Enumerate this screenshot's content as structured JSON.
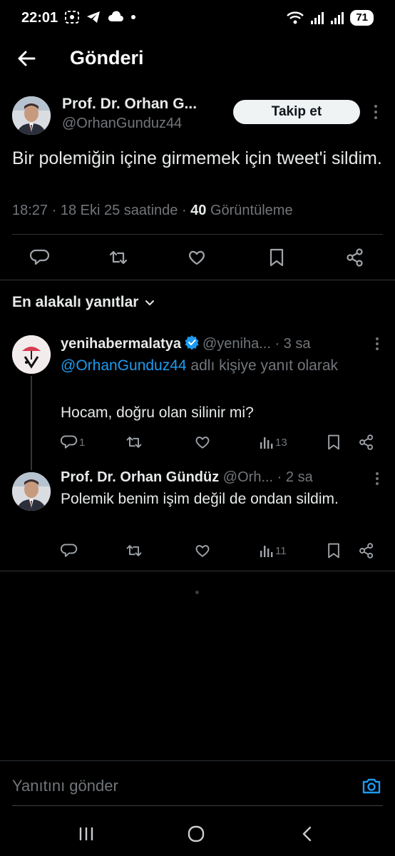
{
  "status_bar": {
    "time": "22:01",
    "battery": "71",
    "icons": [
      "screen-record-icon",
      "telegram-icon",
      "cloud-icon",
      "notification-dot-icon",
      "wifi-icon",
      "signal-icon",
      "signal-icon-2"
    ]
  },
  "header": {
    "title": "Gönderi"
  },
  "post": {
    "author_name": "Prof. Dr. Orhan G...",
    "author_handle": "@OrhanGunduz44",
    "follow_label": "Takip et",
    "text": "Bir  polemiğin içine girmemek için tweet'i sildim.",
    "meta_time": "18:27 · 18 Eki 25 saatinde · ",
    "meta_views_count": "40",
    "meta_views_label": " Görüntüleme"
  },
  "sort_label": "En alakalı yanıtlar",
  "replies": [
    {
      "name": "yenihabermalatya",
      "handle": "@yeniha...",
      "time": " · 3 sa",
      "replying_mention": "@OrhanGunduz44",
      "replying_rest": " adlı kişiye yanıt olarak",
      "text": "Hocam, doğru olan silinir mi?",
      "reply_count": "1",
      "retweet_count": "",
      "like_count": "",
      "view_count": "13"
    },
    {
      "name": "Prof. Dr. Orhan Gündüz",
      "handle": "@Orh...",
      "time": " · 2 sa",
      "text": "Polemik benim işim değil de ondan sildim.",
      "reply_count": "",
      "retweet_count": "",
      "like_count": "",
      "view_count": "11"
    }
  ],
  "compose": {
    "placeholder": "Yanıtını gönder"
  },
  "colors": {
    "background": "#000000",
    "text": "#e7e9ea",
    "muted": "#71767b",
    "accent": "#1d9bf0",
    "divider": "#2f3336"
  }
}
